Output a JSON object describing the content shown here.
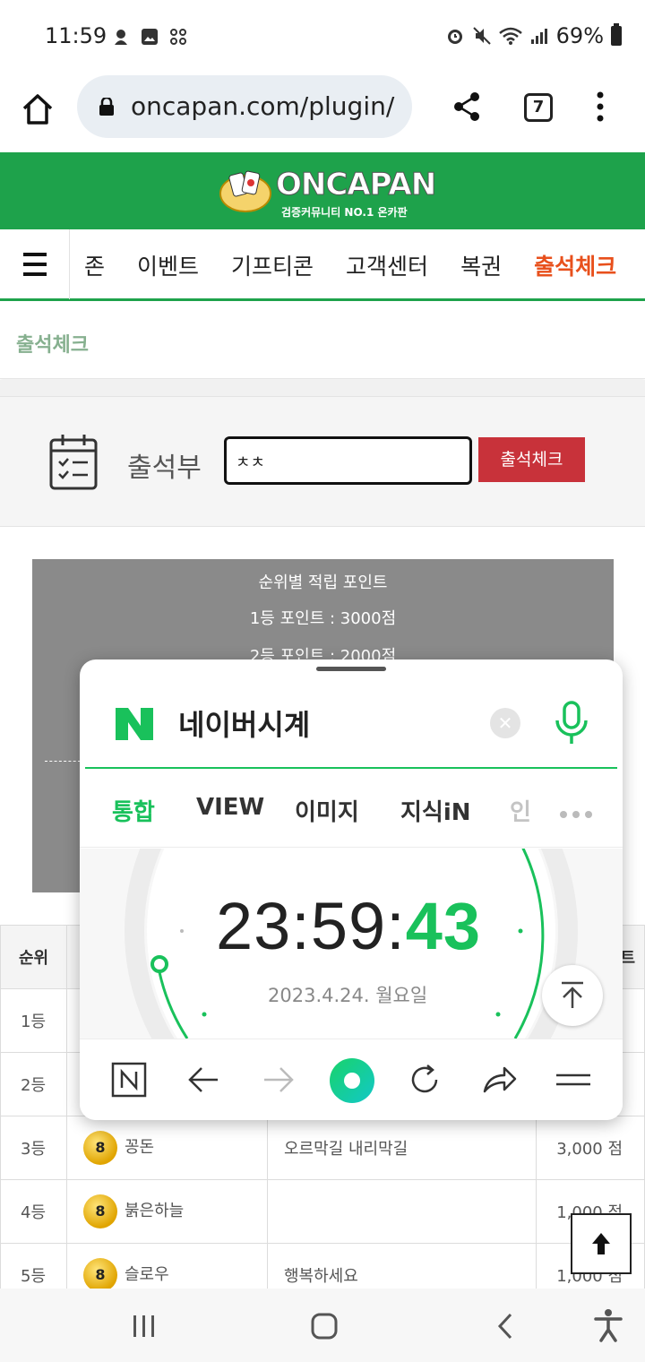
{
  "status_bar": {
    "time": "11:59",
    "battery": "69%"
  },
  "browser": {
    "url": "oncapan.com/plugin/",
    "tab_count": "7"
  },
  "site": {
    "logo_name": "ONCAPAN",
    "logo_sub": "검증커뮤니티 NO.1 온카판",
    "nav_items": [
      "존",
      "이벤트",
      "기프티콘",
      "고객센터",
      "복권",
      "출석체크"
    ],
    "breadcrumb": "출석체크"
  },
  "attendance": {
    "label": "출석부",
    "input_value": "ㅊㅊ",
    "button_label": "출석체크"
  },
  "points_panel": {
    "title": "순위별 적립 포인트",
    "line1": "1등 포인트 : 3000점",
    "line2": "2등 포인트 : 2000점"
  },
  "table": {
    "header_rank": "순위",
    "header_points_partial": "트",
    "rows": [
      {
        "rank": "1등",
        "name": "",
        "message": "",
        "points": ""
      },
      {
        "rank": "2등",
        "name": "",
        "message": "",
        "points": ""
      },
      {
        "rank": "3등",
        "name": "꽁돈",
        "message": "오르막길 내리막길",
        "points": "3,000 점",
        "level": "8"
      },
      {
        "rank": "4등",
        "name": "붉은하늘",
        "message": "",
        "points": "1,000 점",
        "level": "8"
      },
      {
        "rank": "5등",
        "name": "슬로우",
        "message": "행복하세요",
        "points": "1,000 점",
        "level": "8"
      }
    ]
  },
  "naver_widget": {
    "query": "네이버시계",
    "tabs": [
      "통합",
      "VIEW",
      "이미지",
      "지식iN",
      "인"
    ],
    "time_main": "23:59:",
    "time_seconds": "43",
    "date": "2023.4.24. 월요일"
  },
  "colors": {
    "brand_green": "#1ea24b",
    "naver_green": "#19c15b",
    "accent_orange": "#e8501c",
    "button_red": "#c8323a"
  }
}
